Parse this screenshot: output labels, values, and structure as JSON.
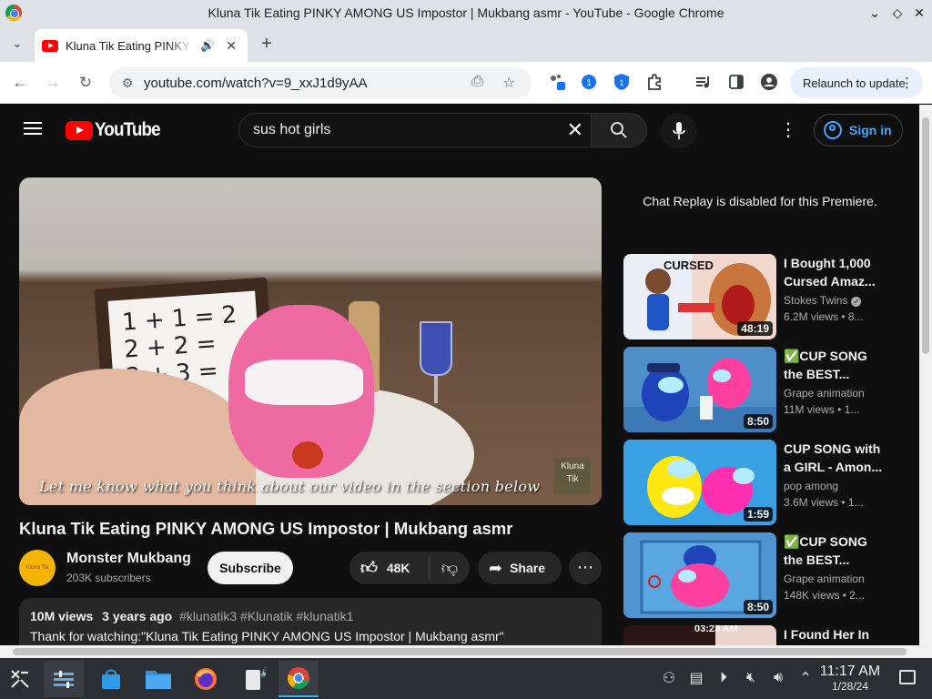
{
  "window": {
    "title": "Kluna Tik Eating PINKY AMONG US Impostor | Mukbang asmr - YouTube - Google Chrome",
    "minimize": "⌄",
    "maximize": "◇",
    "close": "✕"
  },
  "tabs": [
    {
      "title": "Kluna Tik Eating PINKY AMONG US Impostor | Mukbang asmr - YouTube",
      "audio": "🔊",
      "close": "✕"
    }
  ],
  "toolbar": {
    "back": "←",
    "forward": "→",
    "reload": "↻",
    "url": "youtube.com/watch?v=9_xxJ1d9yAA",
    "relaunch_label": "Relaunch to update",
    "menu": "⋮"
  },
  "youtube": {
    "logo_text": "YouTube",
    "search_query": "sus hot girls",
    "clear": "✕",
    "sign_in": "Sign in",
    "more": "⋮"
  },
  "video": {
    "board_lines": [
      "1 + 1 = 2",
      "2 + 2 = ",
      "2 + 3 = "
    ],
    "caption": "Let me know what you think about our video in the section below",
    "watermark": "Kluna Tik",
    "title": "Kluna Tik Eating PINKY AMONG US Impostor | Mukbang asmr",
    "channel": "Monster Mukbang",
    "subscribers": "203K subscribers",
    "avatar_text": "Kluna Tik",
    "subscribe": "Subscribe",
    "likes": "48K",
    "share": "Share",
    "views": "10M views",
    "age": "3 years ago",
    "hashtags": "#klunatik3 #Klunatik #klunatik1",
    "description": "Thank for watching:\"Kluna Tik Eating PINKY AMONG US Impostor | Mukbang asmr\""
  },
  "chat_replay": "Chat Replay is disabled for this Premiere.",
  "recommendations": [
    {
      "title": "I Bought 1,000 Cursed Amaz...",
      "channel": "Stokes Twins",
      "verified": true,
      "meta": "6.2M views • 8...",
      "duration": "48:19",
      "thumb_text": "CURSED"
    },
    {
      "title": "✅CUP SONG the BEST...",
      "channel": "Grape animation",
      "verified": false,
      "meta": "11M views • 1...",
      "duration": "8:50",
      "thumb_text": ""
    },
    {
      "title": "CUP SONG with a GIRL - Amon...",
      "channel": "pop among",
      "verified": false,
      "meta": "3.6M views • 1...",
      "duration": "1:59",
      "thumb_text": ""
    },
    {
      "title": "✅CUP SONG the BEST...",
      "channel": "Grape animation",
      "verified": false,
      "meta": "148K views • 2...",
      "duration": "8:50",
      "thumb_text": ""
    },
    {
      "title": "I Found Her In",
      "channel": "",
      "verified": false,
      "meta": "",
      "duration": "",
      "thumb_text": "03:23 AM"
    }
  ],
  "taskbar": {
    "clock_time": "11:17 AM",
    "clock_date": "1/28/24"
  }
}
